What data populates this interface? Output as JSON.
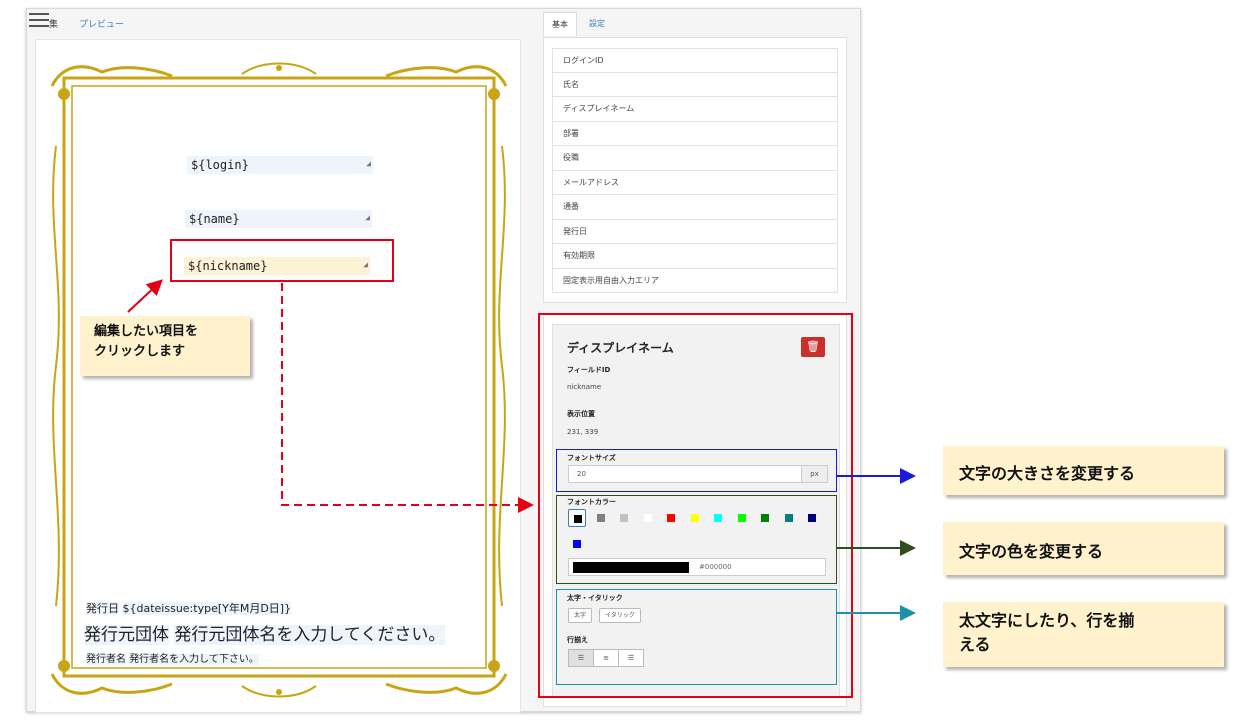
{
  "editor": {
    "tabs": {
      "edit": "集",
      "preview": "プレビュー"
    },
    "certificate": {
      "fields": [
        {
          "text": "${login}"
        },
        {
          "text": "${name}"
        },
        {
          "text": "${nickname}"
        }
      ],
      "issue_date_label": "発行日",
      "issue_date_value": "${dateissue:type[Y年M月D日]}",
      "issuer_org_label": "発行元団体",
      "issuer_org_value": "発行元団体名を入力してください。",
      "issuer_name_label": "発行者名",
      "issuer_name_value": "発行者名を入力して下さい。"
    }
  },
  "right_panel": {
    "tabs": {
      "basic": "基本",
      "settings": "設定"
    },
    "field_list": [
      "ログインID",
      "氏名",
      "ディスプレイネーム",
      "部署",
      "役職",
      "メールアドレス",
      "通番",
      "発行日",
      "有効期限",
      "固定表示用自由入力エリア"
    ],
    "properties": {
      "title": "ディスプレイネーム",
      "delete_icon": "trash-icon",
      "field_id_label": "フィールドID",
      "field_id_value": "nickname",
      "position_label": "表示位置",
      "position_value": "231, 339",
      "font_size_label": "フォントサイズ",
      "font_size_value": "20",
      "font_size_unit": "px",
      "font_color_label": "フォントカラー",
      "swatches": [
        "#000000",
        "#808080",
        "#c0c0c0",
        "#ffffff",
        "#ff0000",
        "#ffff00",
        "#00ffff",
        "#00ff00",
        "#008000",
        "#008080",
        "#000080",
        "#0000ff"
      ],
      "selected_color": "#000000",
      "color_hex": "#000000",
      "style_label": "太字・イタリック",
      "bold_label": "太字",
      "italic_label": "イタリック",
      "align_label": "行揃え",
      "align_icons": [
        "align-left-icon",
        "align-center-icon",
        "align-right-icon"
      ]
    }
  },
  "annotations": {
    "edit_callout": [
      "編集したい項目を",
      "クリックします"
    ],
    "size_callout": "文字の大きさを変更する",
    "color_callout": "文字の色を変更する",
    "style_callout": [
      "太文字にしたり、行を揃",
      "える"
    ],
    "colors": {
      "red": "#e60012",
      "blue": "#1a1ad8",
      "green": "#2e4e1e",
      "cyan": "#1a93a8",
      "callout_bg": "#fff2cc",
      "gold": "#c9a415"
    }
  }
}
